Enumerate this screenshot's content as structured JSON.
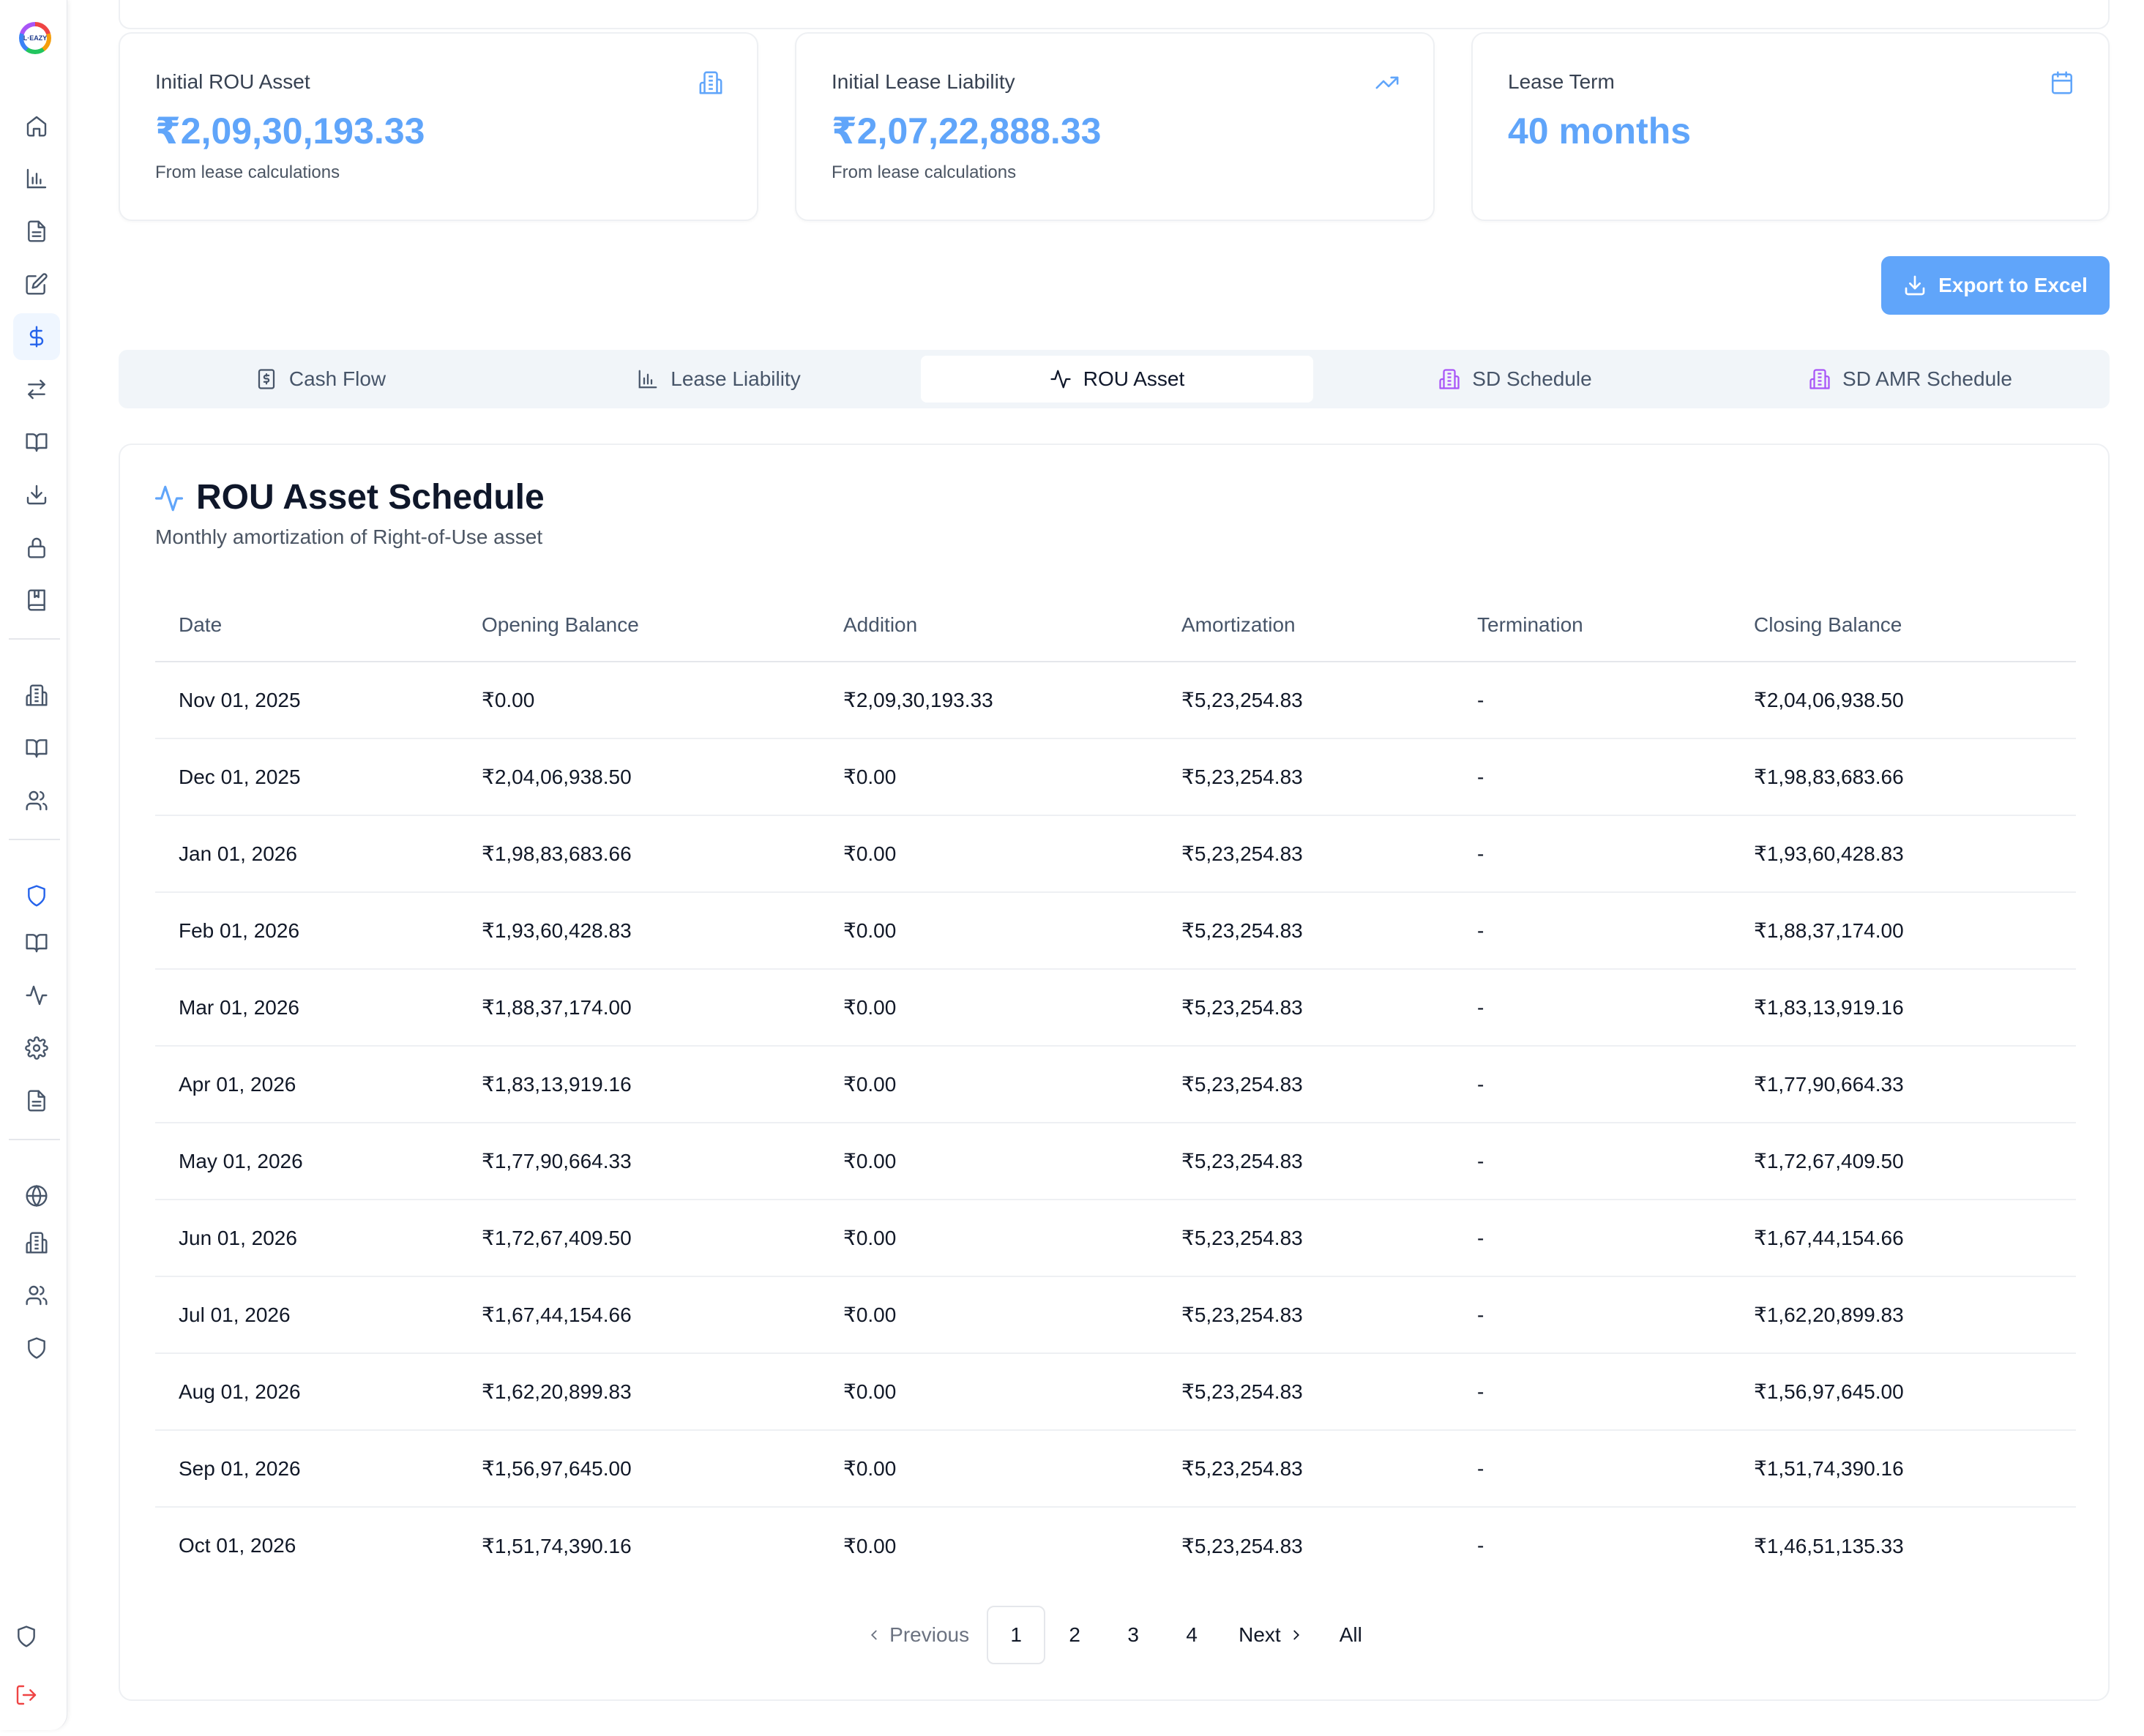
{
  "sidebar": {
    "logo_text": "L·EAZY",
    "icons": [
      "home-icon",
      "bar-chart-icon",
      "file-text-icon",
      "edit-icon",
      "dollar-icon",
      "transfer-icon",
      "book-open-icon",
      "download-icon",
      "lock-icon",
      "bookmark-book-icon",
      "building-icon",
      "book-open-icon",
      "users-icon",
      "shield-icon",
      "book-open-icon",
      "activity-icon",
      "gear-icon",
      "file-text-icon",
      "globe-icon",
      "building-icon",
      "users-icon",
      "shield-icon",
      "shield-icon",
      "logout-icon"
    ],
    "active_icon": "dollar-icon"
  },
  "cards": [
    {
      "title": "Initial ROU Asset",
      "value": "₹2,09,30,193.33",
      "sub": "From lease calculations",
      "icon": "building-icon"
    },
    {
      "title": "Initial Lease Liability",
      "value": "₹2,07,22,888.33",
      "sub": "From lease calculations",
      "icon": "trending-up-icon"
    },
    {
      "title": "Lease Term",
      "value": "40 months",
      "sub": "",
      "icon": "calendar-icon"
    }
  ],
  "export_label": "Export to Excel",
  "tabs": [
    {
      "label": "Cash Flow",
      "icon": "receipt-icon"
    },
    {
      "label": "Lease Liability",
      "icon": "bar-chart-icon"
    },
    {
      "label": "ROU Asset",
      "icon": "activity-icon"
    },
    {
      "label": "SD Schedule",
      "icon": "building-icon"
    },
    {
      "label": "SD AMR Schedule",
      "icon": "building-icon"
    }
  ],
  "active_tab": "ROU Asset",
  "schedule": {
    "title": "ROU Asset Schedule",
    "subtitle": "Monthly amortization of Right-of-Use asset",
    "columns": [
      "Date",
      "Opening Balance",
      "Addition",
      "Amortization",
      "Termination",
      "Closing Balance"
    ],
    "rows": [
      [
        "Nov 01, 2025",
        "₹0.00",
        "₹2,09,30,193.33",
        "₹5,23,254.83",
        "-",
        "₹2,04,06,938.50"
      ],
      [
        "Dec 01, 2025",
        "₹2,04,06,938.50",
        "₹0.00",
        "₹5,23,254.83",
        "-",
        "₹1,98,83,683.66"
      ],
      [
        "Jan 01, 2026",
        "₹1,98,83,683.66",
        "₹0.00",
        "₹5,23,254.83",
        "-",
        "₹1,93,60,428.83"
      ],
      [
        "Feb 01, 2026",
        "₹1,93,60,428.83",
        "₹0.00",
        "₹5,23,254.83",
        "-",
        "₹1,88,37,174.00"
      ],
      [
        "Mar 01, 2026",
        "₹1,88,37,174.00",
        "₹0.00",
        "₹5,23,254.83",
        "-",
        "₹1,83,13,919.16"
      ],
      [
        "Apr 01, 2026",
        "₹1,83,13,919.16",
        "₹0.00",
        "₹5,23,254.83",
        "-",
        "₹1,77,90,664.33"
      ],
      [
        "May 01, 2026",
        "₹1,77,90,664.33",
        "₹0.00",
        "₹5,23,254.83",
        "-",
        "₹1,72,67,409.50"
      ],
      [
        "Jun 01, 2026",
        "₹1,72,67,409.50",
        "₹0.00",
        "₹5,23,254.83",
        "-",
        "₹1,67,44,154.66"
      ],
      [
        "Jul 01, 2026",
        "₹1,67,44,154.66",
        "₹0.00",
        "₹5,23,254.83",
        "-",
        "₹1,62,20,899.83"
      ],
      [
        "Aug 01, 2026",
        "₹1,62,20,899.83",
        "₹0.00",
        "₹5,23,254.83",
        "-",
        "₹1,56,97,645.00"
      ],
      [
        "Sep 01, 2026",
        "₹1,56,97,645.00",
        "₹0.00",
        "₹5,23,254.83",
        "-",
        "₹1,51,74,390.16"
      ],
      [
        "Oct 01, 2026",
        "₹1,51,74,390.16",
        "₹0.00",
        "₹5,23,254.83",
        "-",
        "₹1,46,51,135.33"
      ]
    ]
  },
  "pagination": {
    "previous": "Previous",
    "pages": [
      "1",
      "2",
      "3",
      "4"
    ],
    "current": "1",
    "next": "Next",
    "all": "All"
  },
  "colors": {
    "accent": "#60a5fa",
    "tab_building_icon": "#a855f7",
    "logout": "#ef4444"
  }
}
